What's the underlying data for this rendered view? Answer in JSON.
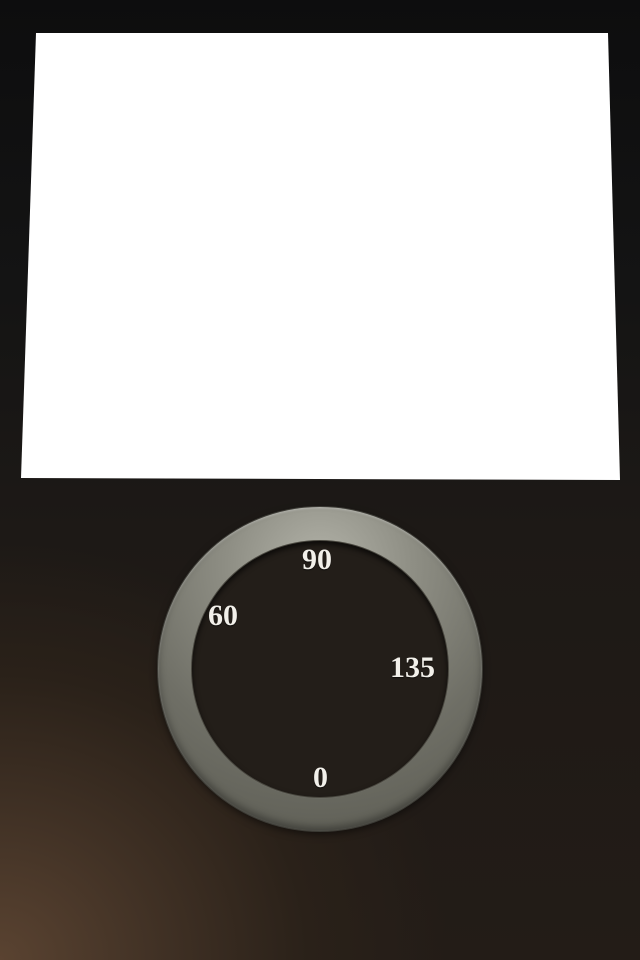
{
  "screen": {
    "fill_color": "#ffffff"
  },
  "dial": {
    "labels": {
      "top": "90",
      "upper_left": "60",
      "right": "135",
      "bottom": "0"
    },
    "ring_color": "#8a8a80",
    "face_color": "#231e19"
  }
}
